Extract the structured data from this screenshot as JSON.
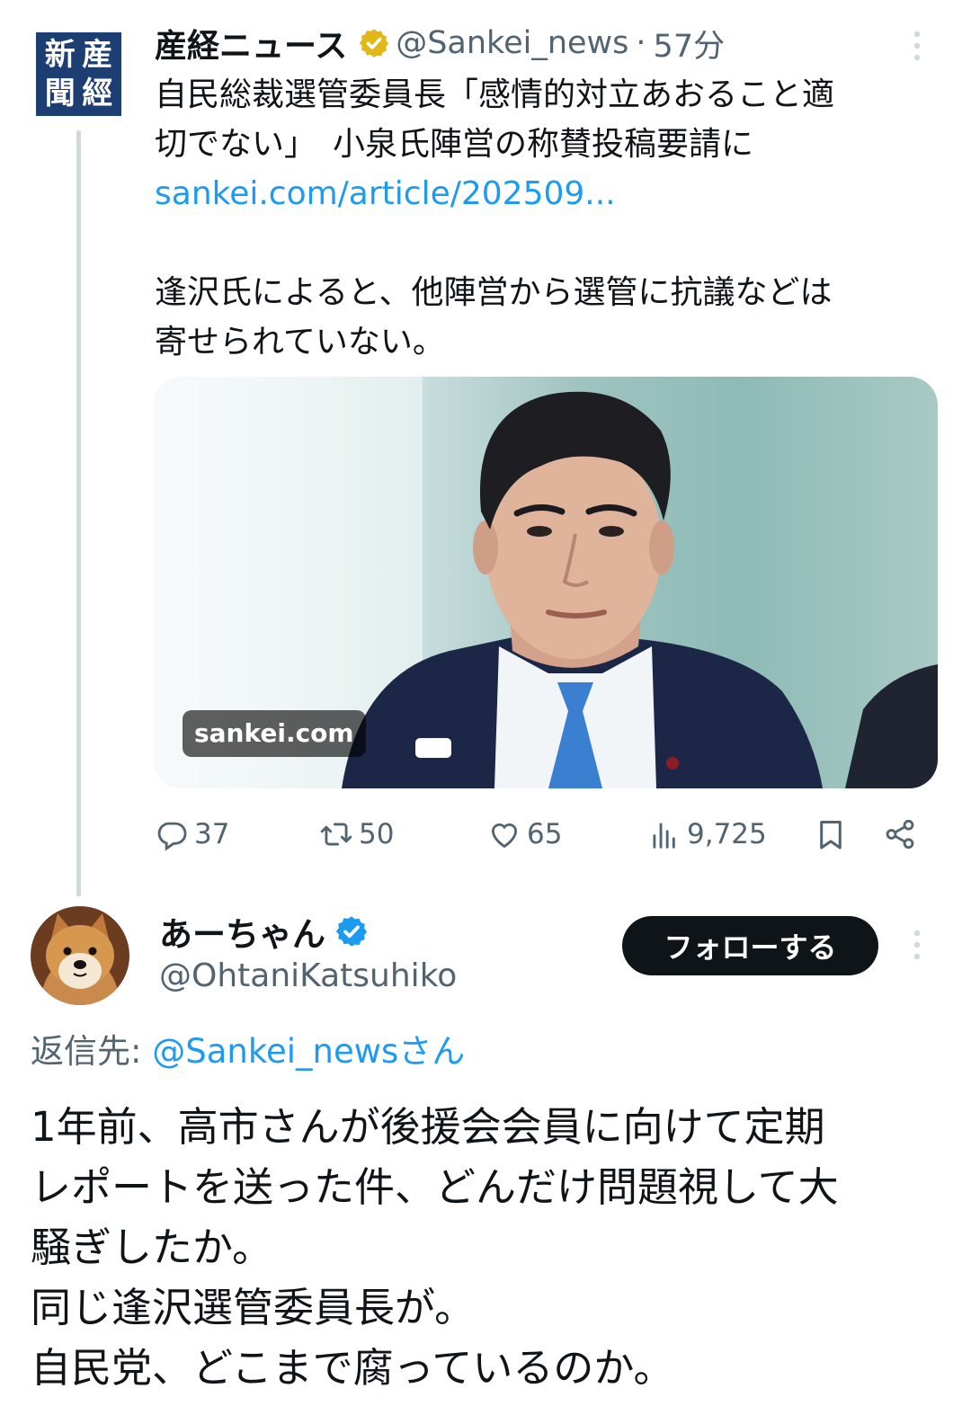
{
  "tweet": {
    "logo_chars": [
      "新",
      "産",
      "聞",
      "經"
    ],
    "author_name": "産経ニュース",
    "handle": "@Sankei_news",
    "separator": "·",
    "time": "57分",
    "text_lines": [
      "自民総裁選管委員長「感情的対立あおること適",
      "切でない」　小泉氏陣営の称賛投稿要請に"
    ],
    "link": "sankei.com/article/202509...",
    "text2_lines": [
      "逢沢氏によると、他陣営から選管に抗議などは",
      "寄せられていない。"
    ],
    "media_label": "sankei.com",
    "stats": {
      "replies": "37",
      "retweets": "50",
      "likes": "65",
      "views": "9,725"
    },
    "icons": [
      "verified-gold-icon",
      "reply-icon",
      "retweet-icon",
      "like-icon",
      "views-icon",
      "bookmark-icon",
      "share-icon",
      "more-icon"
    ]
  },
  "reply": {
    "author_name": "あーちゃん",
    "handle": "@OhtaniKatsuhiko",
    "follow_label": "フォローする",
    "reply_to_prefix": "返信先: ",
    "reply_to_handle": "@Sankei_newsさん",
    "text_lines": [
      "1年前、高市さんが後援会会員に向けて定期",
      "レポートを送った件、どんだけ問題視して大",
      "騒ぎしたか。",
      "同じ逢沢選管委員長が。",
      "自民党、どこまで腐っているのか。"
    ],
    "icons": [
      "verified-blue-icon",
      "more-icon"
    ]
  },
  "colors": {
    "text": "#0f1419",
    "secondary": "#536471",
    "link": "#1d9bf0",
    "thread_line": "#cfd9de",
    "logo_bg": "#1d3e72",
    "verified_gold": "#e2b719",
    "verified_blue": "#1d9bf0"
  }
}
